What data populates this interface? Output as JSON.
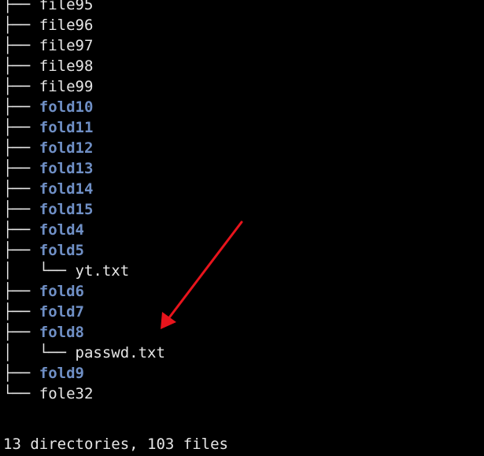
{
  "tree": {
    "entries": [
      {
        "prefix": "├── ",
        "name": "file95",
        "type": "file"
      },
      {
        "prefix": "├── ",
        "name": "file96",
        "type": "file"
      },
      {
        "prefix": "├── ",
        "name": "file97",
        "type": "file"
      },
      {
        "prefix": "├── ",
        "name": "file98",
        "type": "file"
      },
      {
        "prefix": "├── ",
        "name": "file99",
        "type": "file"
      },
      {
        "prefix": "├── ",
        "name": "fold10",
        "type": "dir"
      },
      {
        "prefix": "├── ",
        "name": "fold11",
        "type": "dir"
      },
      {
        "prefix": "├── ",
        "name": "fold12",
        "type": "dir"
      },
      {
        "prefix": "├── ",
        "name": "fold13",
        "type": "dir"
      },
      {
        "prefix": "├── ",
        "name": "fold14",
        "type": "dir"
      },
      {
        "prefix": "├── ",
        "name": "fold15",
        "type": "dir"
      },
      {
        "prefix": "├── ",
        "name": "fold4",
        "type": "dir"
      },
      {
        "prefix": "├── ",
        "name": "fold5",
        "type": "dir"
      },
      {
        "prefix": "│   └── ",
        "name": "yt.txt",
        "type": "file"
      },
      {
        "prefix": "├── ",
        "name": "fold6",
        "type": "dir"
      },
      {
        "prefix": "├── ",
        "name": "fold7",
        "type": "dir"
      },
      {
        "prefix": "├── ",
        "name": "fold8",
        "type": "dir"
      },
      {
        "prefix": "│   └── ",
        "name": "passwd.txt",
        "type": "file"
      },
      {
        "prefix": "├── ",
        "name": "fold9",
        "type": "dir"
      },
      {
        "prefix": "└── ",
        "name": "fole32",
        "type": "file"
      }
    ]
  },
  "summary": "13 directories, 103 files",
  "colors": {
    "background": "#000000",
    "text": "#e6e6e6",
    "directory": "#6f8fc5",
    "arrow": "#e8141c"
  }
}
